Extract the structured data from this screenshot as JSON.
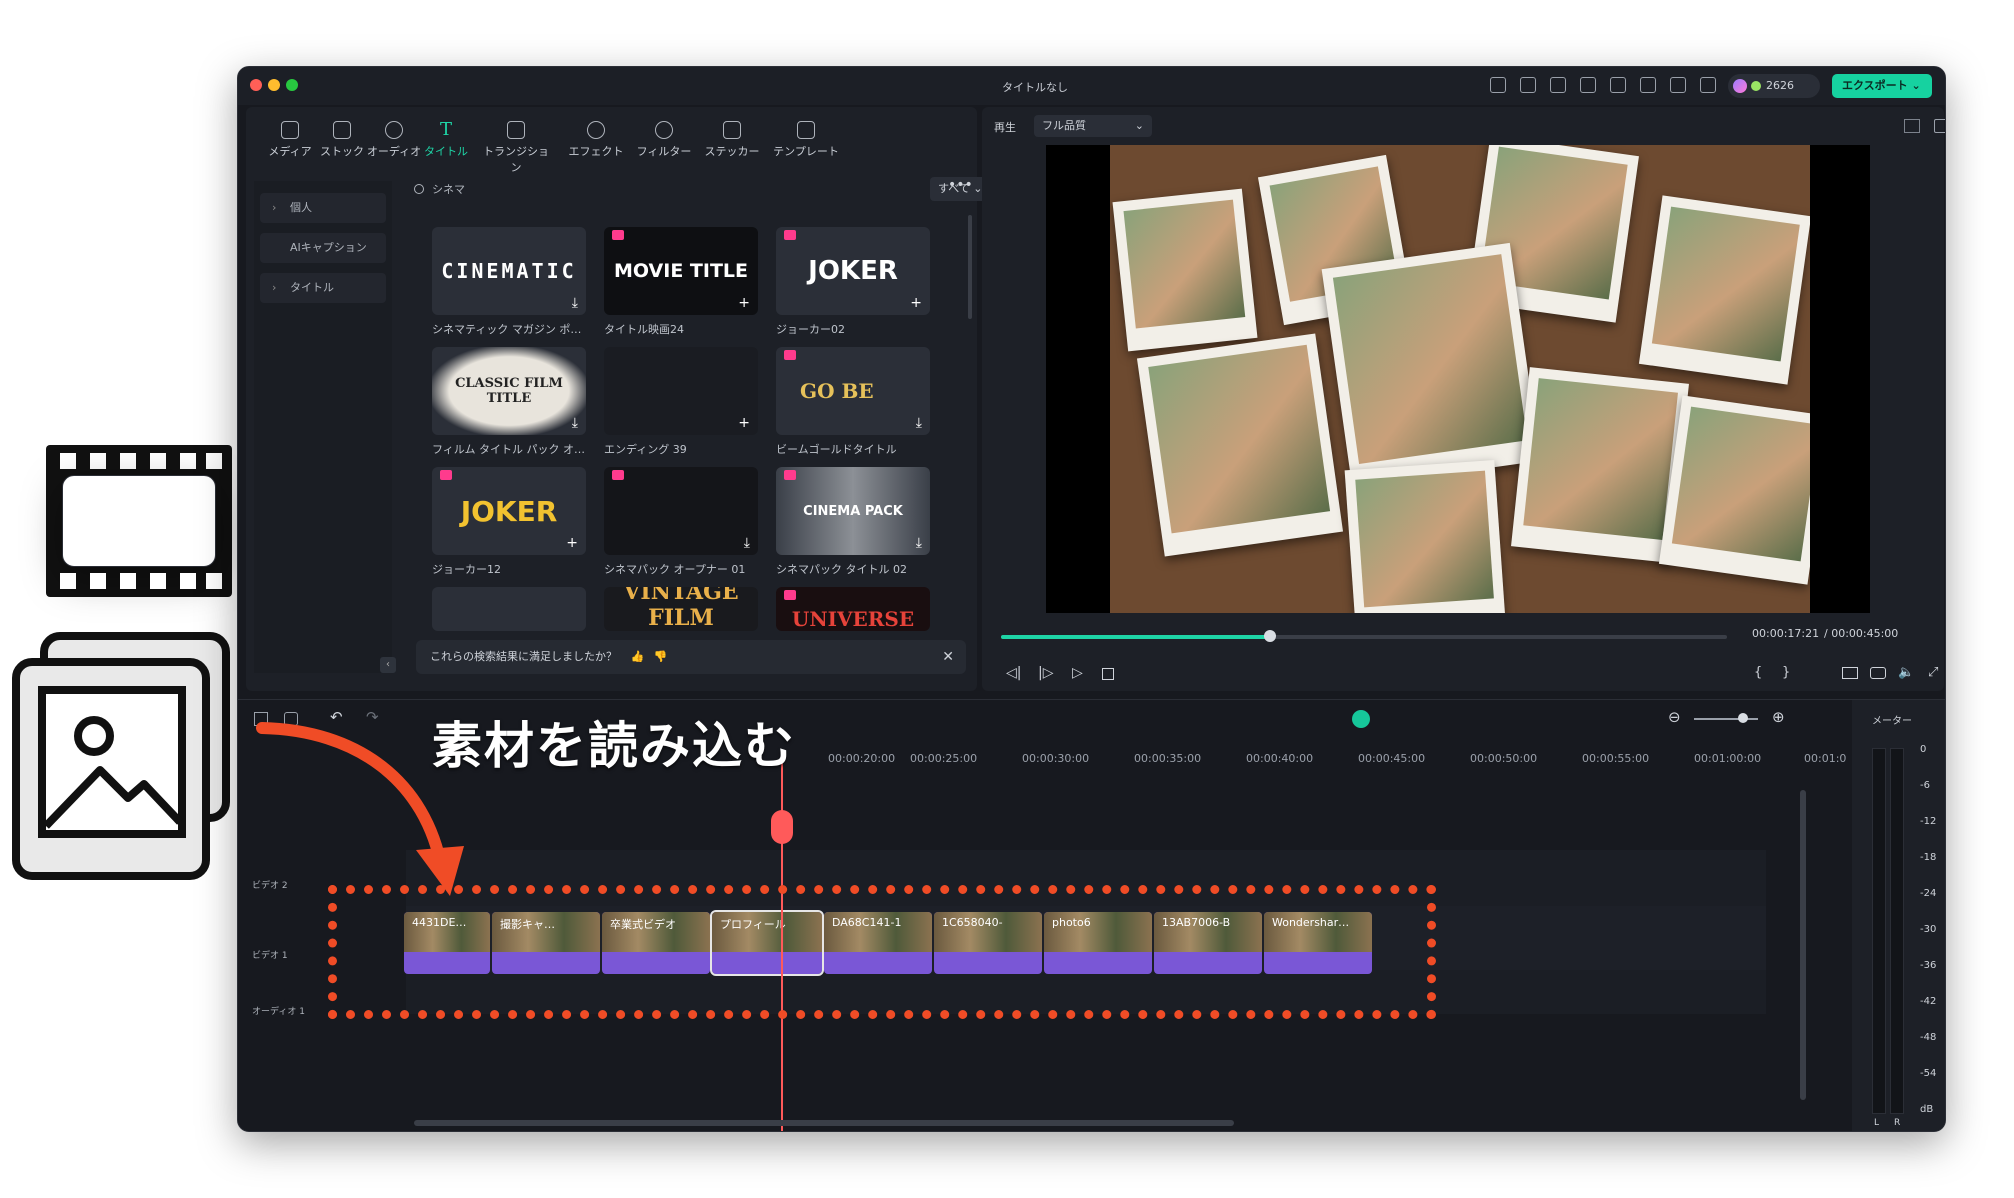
{
  "window": {
    "title": "タイトルなし",
    "credits": "2626",
    "export_label": "エクスポート"
  },
  "nav_tabs": [
    {
      "label": "メディア"
    },
    {
      "label": "ストック"
    },
    {
      "label": "オーディオ"
    },
    {
      "label": "タイトル"
    },
    {
      "label": "トランジション"
    },
    {
      "label": "エフェクト"
    },
    {
      "label": "フィルター"
    },
    {
      "label": "ステッカー"
    },
    {
      "label": "テンプレート"
    }
  ],
  "sidebar": {
    "items": [
      {
        "label": "個人"
      },
      {
        "label": "AIキャプション"
      },
      {
        "label": "タイトル"
      }
    ]
  },
  "search": {
    "value": "シネマ",
    "filter": "すべて"
  },
  "cards": [
    {
      "art": "CINEMATIC",
      "label": "シネマティック マガジン ポ…"
    },
    {
      "art": "MOVIE TITLE",
      "label": "タイトル映画24"
    },
    {
      "art": "JOKER",
      "label": "ジョーカー02"
    },
    {
      "art": "CLASSIC FILM TITLE",
      "label": "フィルム タイトル パック オ…"
    },
    {
      "art": "",
      "label": "エンディング 39"
    },
    {
      "art": "GO BE",
      "label": "ビームゴールドタイトル"
    },
    {
      "art": "JOKER",
      "label": "ジョーカー12"
    },
    {
      "art": "",
      "label": "シネマパック オープナー 01"
    },
    {
      "art": "CINEMA PACK",
      "label": "シネマパック タイトル 02"
    },
    {
      "art": "",
      "label": ""
    },
    {
      "art": "VINTAGE FILM",
      "label": ""
    },
    {
      "art": "UNIVERSE",
      "label": ""
    }
  ],
  "feedback": {
    "text": "これらの検索結果に満足しましたか？"
  },
  "preview": {
    "mode_label": "再生",
    "quality": "フル品質",
    "current_time": "00:00:17:21",
    "total_time": "/ 00:00:45:00",
    "progress": 0.37
  },
  "timeline": {
    "ruler": [
      "00:00:20:00",
      "00:00:25:00",
      "00:00:30:00",
      "00:00:35:00",
      "00:00:40:00",
      "00:00:45:00",
      "00:00:50:00",
      "00:00:55:00",
      "00:01:00:00",
      "00:01:0"
    ],
    "tracks": [
      {
        "label": "ビデオ 2"
      },
      {
        "label": "ビデオ 1"
      },
      {
        "label": "オーディオ 1"
      }
    ],
    "clips": [
      {
        "name": "4431DE…"
      },
      {
        "name": "撮影キャ…"
      },
      {
        "name": "卒業式ビデオ"
      },
      {
        "name": "プロフィール"
      },
      {
        "name": "DA68C141-1"
      },
      {
        "name": "1C658040-"
      },
      {
        "name": "photo6"
      },
      {
        "name": "13AB7006-B"
      },
      {
        "name": "Wondershar…"
      }
    ]
  },
  "meter": {
    "label": "メーター",
    "levels": [
      "0",
      "-6",
      "-12",
      "-18",
      "-24",
      "-30",
      "-36",
      "-42",
      "-48",
      "-54",
      "dB"
    ],
    "channels": [
      "L",
      "R"
    ]
  },
  "annotation": {
    "text": "素材を読み込む",
    "color": "#f04c26"
  }
}
